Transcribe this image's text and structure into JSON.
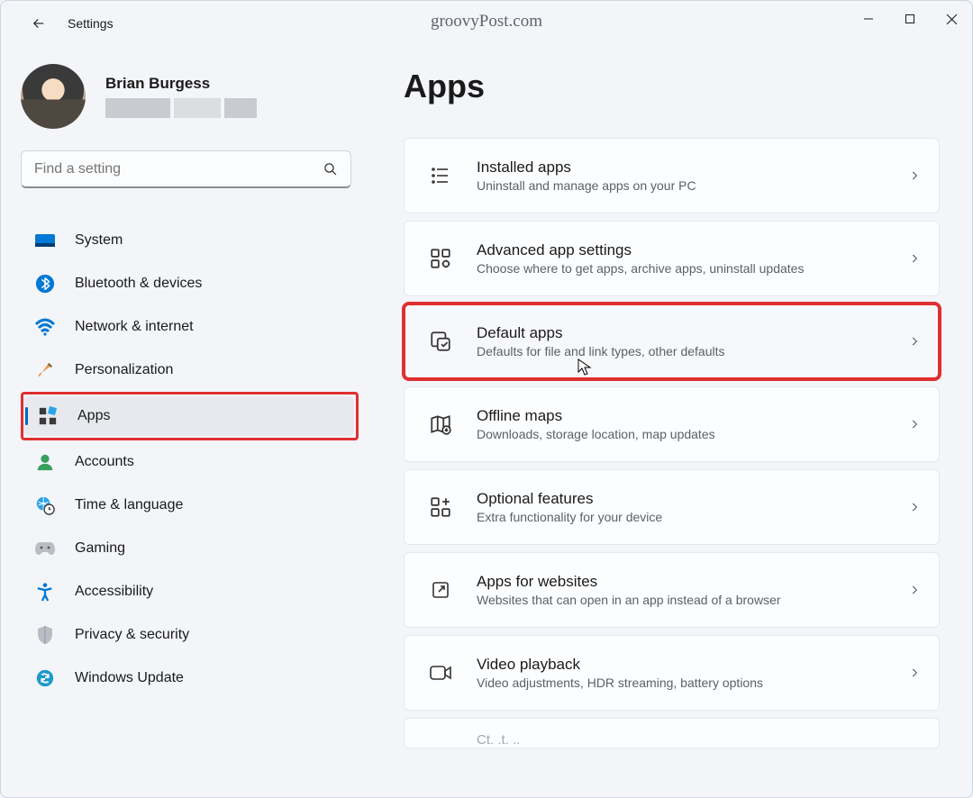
{
  "title": "Settings",
  "watermark": "groovyPost.com",
  "user": {
    "name": "Brian Burgess"
  },
  "search": {
    "placeholder": "Find a setting"
  },
  "nav": [
    {
      "label": "System"
    },
    {
      "label": "Bluetooth & devices"
    },
    {
      "label": "Network & internet"
    },
    {
      "label": "Personalization"
    },
    {
      "label": "Apps"
    },
    {
      "label": "Accounts"
    },
    {
      "label": "Time & language"
    },
    {
      "label": "Gaming"
    },
    {
      "label": "Accessibility"
    },
    {
      "label": "Privacy & security"
    },
    {
      "label": "Windows Update"
    }
  ],
  "page": {
    "title": "Apps",
    "cards": [
      {
        "title": "Installed apps",
        "sub": "Uninstall and manage apps on your PC"
      },
      {
        "title": "Advanced app settings",
        "sub": "Choose where to get apps, archive apps, uninstall updates"
      },
      {
        "title": "Default apps",
        "sub": "Defaults for file and link types, other defaults"
      },
      {
        "title": "Offline maps",
        "sub": "Downloads, storage location, map updates"
      },
      {
        "title": "Optional features",
        "sub": "Extra functionality for your device"
      },
      {
        "title": "Apps for websites",
        "sub": "Websites that can open in an app instead of a browser"
      },
      {
        "title": "Video playback",
        "sub": "Video adjustments, HDR streaming, battery options"
      },
      {
        "title": "Startup",
        "sub": ""
      }
    ]
  }
}
